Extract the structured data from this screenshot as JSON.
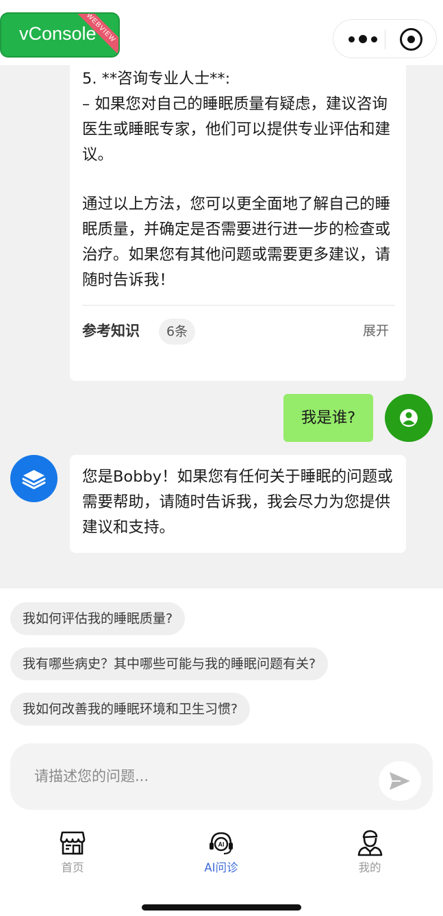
{
  "vconsole": {
    "label": "vConsole",
    "ribbon": "WEBVIEW"
  },
  "capsule": {
    "more_icon": "more-dots-icon",
    "close_icon": "target-close-icon"
  },
  "messages": {
    "ai_reply_1": {
      "paragraph_1": "5. **咨询专业人士**:\n– 如果您对自己的睡眠质量有疑虑，建议咨询医生或睡眠专家，他们可以提供专业评估和建议。",
      "paragraph_2": "通过以上方法，您可以更全面地了解自己的睡眠质量，并确定是否需要进行进一步的检查或治疗。如果您有其他问题或需要更多建议，请随时告诉我！",
      "reference_title": "参考知识",
      "reference_count": "6条",
      "expand_label": "展开"
    },
    "user_question": "我是谁?",
    "ai_reply_2": "您是Bobby！如果您有任何关于睡眠的问题或需要帮助，请随时告诉我，我会尽力为您提供建议和支持。"
  },
  "suggestions": [
    "我如何评估我的睡眠质量?",
    "我有哪些病史？其中哪些可能与我的睡眠问题有关?",
    "我如何改善我的睡眠环境和卫生习惯?"
  ],
  "input": {
    "placeholder": "请描述您的问题...",
    "value": ""
  },
  "tabs": [
    {
      "label": "首页",
      "icon": "storefront-icon",
      "active": false
    },
    {
      "label": "AI问诊",
      "icon": "ai-headset-icon",
      "active": true
    },
    {
      "label": "我的",
      "icon": "doctor-profile-icon",
      "active": false
    }
  ],
  "colors": {
    "accent_blue": "#3d6ad6",
    "user_bubble": "#95eb6a",
    "user_avatar": "#25a017",
    "ai_avatar": "#1677e8",
    "vconsole_green": "#22b34a"
  }
}
